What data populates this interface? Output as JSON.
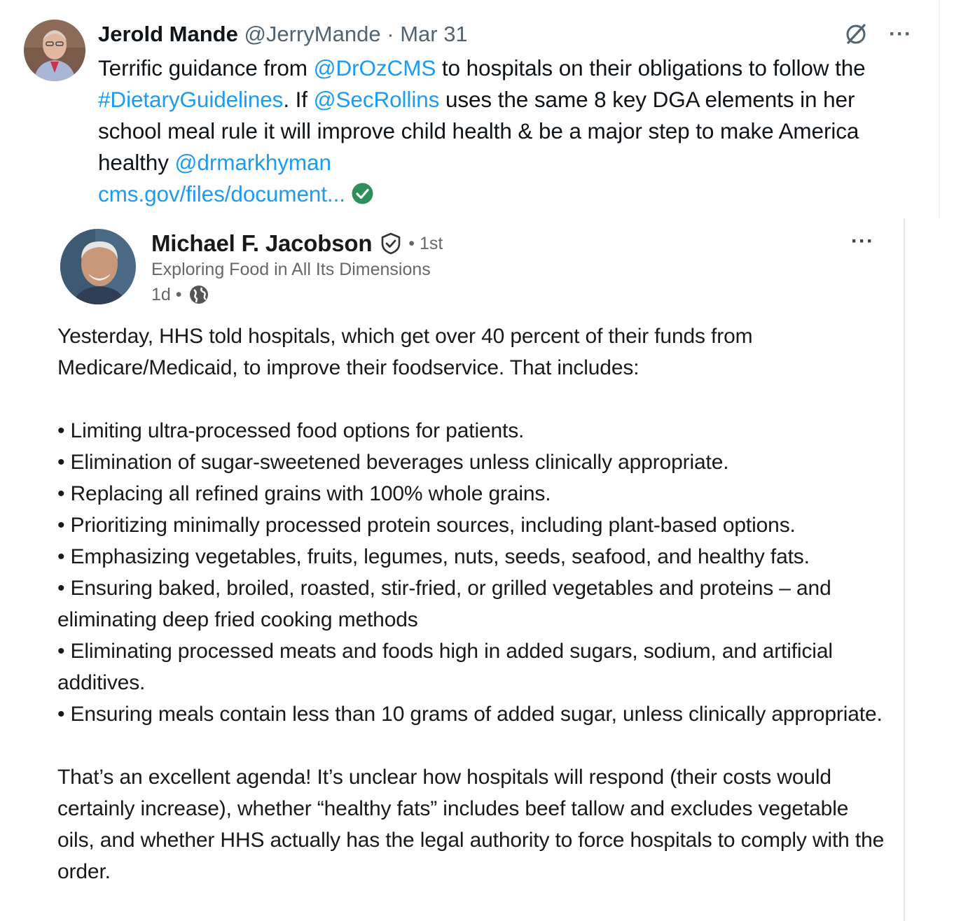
{
  "tweet": {
    "author_name": "Jerold Mande",
    "handle": "@JerryMande",
    "separator": "·",
    "date": "Mar 31",
    "more_label": "···",
    "text_segments": [
      {
        "text": "Terrific guidance from ",
        "type": "plain"
      },
      {
        "text": "@DrOzCMS",
        "type": "link"
      },
      {
        "text": " to hospitals on their obligations to follow the ",
        "type": "plain"
      },
      {
        "text": "#DietaryGuidelines",
        "type": "link"
      },
      {
        "text": ". If ",
        "type": "plain"
      },
      {
        "text": "@SecRollins",
        "type": "link"
      },
      {
        "text": " uses the same 8 key DGA elements in her school meal rule it will improve child health & be a major step to make America healthy ",
        "type": "plain"
      },
      {
        "text": "@drmarkhyman",
        "type": "link"
      }
    ],
    "url_text": "cms.gov/files/document...",
    "colors": {
      "link": "#1d9bf0",
      "text": "#0f1419",
      "muted": "#536471",
      "verified_check": "#2f8f5b"
    },
    "icons": [
      "grok-icon",
      "more-options-icon",
      "verified-link-icon"
    ]
  },
  "linkedin_post": {
    "author_name": "Michael F. Jacobson",
    "degree": "• 1st",
    "headline": "Exploring Food in All Its Dimensions",
    "time": "1d •",
    "more_label": "···",
    "icons": [
      "verified-shield-icon",
      "globe-icon",
      "more-options-icon"
    ],
    "intro": "Yesterday, HHS told hospitals, which get over 40 percent of their funds from Medicare/Medicaid, to improve their foodservice. That includes:",
    "bullets": [
      "• Limiting ultra-processed food options for patients.",
      "• Elimination of sugar-sweetened beverages unless clinically appropriate.",
      "• Replacing all refined grains with 100% whole grains.",
      "• Prioritizing minimally processed protein sources, including plant-based options.",
      "• Emphasizing vegetables, fruits, legumes, nuts, seeds, seafood, and healthy fats.",
      "• Ensuring baked, broiled, roasted, stir-fried, or grilled vegetables and proteins – and eliminating deep fried cooking methods",
      "• Eliminating processed meats and foods high in added sugars, sodium, and artificial additives.",
      "• Ensuring meals contain less than 10 grams of added sugar, unless clinically appropriate."
    ],
    "conclusion": "That’s an excellent agenda! It’s unclear how hospitals will respond (their costs would certainly increase), whether “healthy fats” includes beef tallow and excludes vegetable oils, and whether HHS actually has the legal authority to force hospitals to comply with the order."
  }
}
